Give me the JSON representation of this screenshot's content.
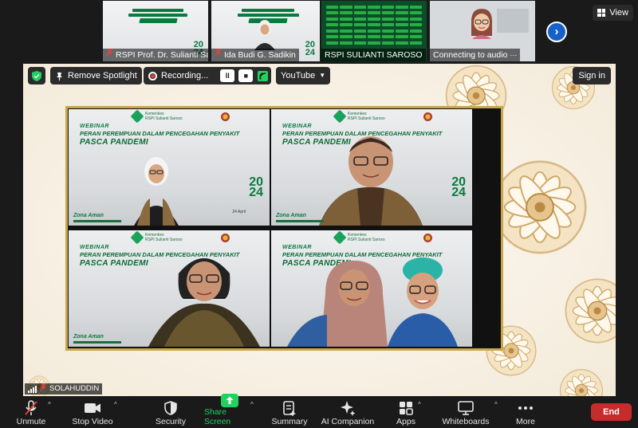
{
  "filmstrip": {
    "participants": [
      {
        "name": "RSPI Prof. Dr. Sulianti Saroso",
        "muted": true,
        "type": "slide"
      },
      {
        "name": "Ida Budi G. Sadikin",
        "muted": true,
        "type": "slide"
      },
      {
        "name": "RSPI SULIANTI SAROSO",
        "muted": false,
        "type": "green"
      },
      {
        "name": "Connecting to audio",
        "muted": false,
        "type": "room"
      }
    ],
    "view_label": "View"
  },
  "stage_toolbar": {
    "remove_spotlight": "Remove Spotlight",
    "recording": "Recording...",
    "youtube": "YouTube",
    "sign_in": "Sign in"
  },
  "slide": {
    "webinar": "WEBINAR",
    "title_line1": "PERAN PEREMPUAN DALAM PENCEGAHAN PENYAKIT",
    "title_line2": "PASCA PANDEMI",
    "year_top": "20",
    "year_bottom": "24",
    "zona": "Zona Aman",
    "date": "24 April"
  },
  "spotlight_name": "SOLAHUDDIN",
  "toolbar": {
    "unmute": "Unmute",
    "stop_video": "Stop Video",
    "security": "Security",
    "share_screen": "Share Screen",
    "summary": "Summary",
    "ai_companion": "AI Companion",
    "apps": "Apps",
    "whiteboards": "Whiteboards",
    "more": "More",
    "end": "End"
  },
  "colors": {
    "share_green": "#23d160",
    "end_red": "#c72c2c",
    "frame_gold": "#c9a64a",
    "slide_green": "#0b7a3f"
  }
}
